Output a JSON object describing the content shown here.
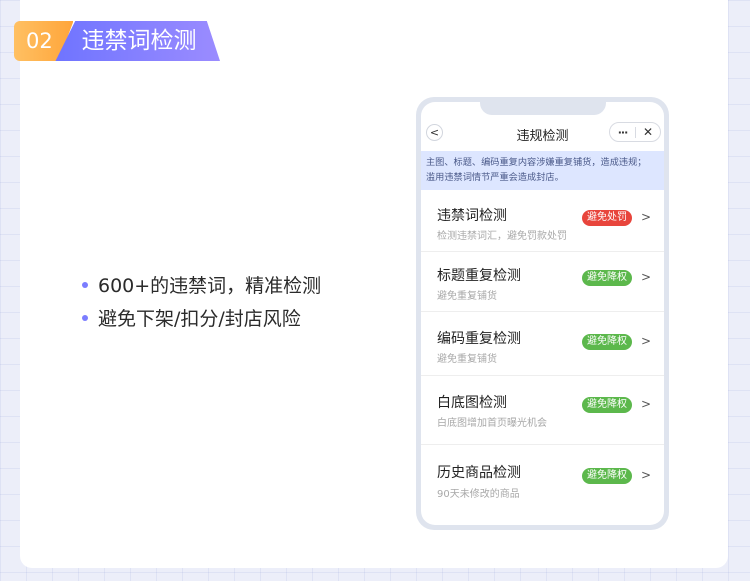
{
  "section": {
    "number": "02",
    "title": "违禁词检测"
  },
  "bullets": [
    "600+的违禁词，精准检测",
    "避免下架/扣分/封店风险"
  ],
  "phone": {
    "nav_title": "违规检测",
    "back_glyph": "<",
    "more_glyph": "···",
    "close_glyph": "✕",
    "notice_line1": "主图、标题、编码重复内容涉嫌重复铺货，造成违规；",
    "notice_line2": "滥用违禁词情节严重会造成封店。",
    "items": [
      {
        "title": "违禁词检测",
        "subtitle": "检测违禁词汇，避免罚款处罚",
        "tag": "避免处罚",
        "tag_color": "#e8453c"
      },
      {
        "title": "标题重复检测",
        "subtitle": "避免重复铺货",
        "tag": "避免降权",
        "tag_color": "#5cb84c"
      },
      {
        "title": "编码重复检测",
        "subtitle": "避免重复铺货",
        "tag": "避免降权",
        "tag_color": "#5cb84c"
      },
      {
        "title": "白底图检测",
        "subtitle": "白底图增加首页曝光机会",
        "tag": "避免降权",
        "tag_color": "#5cb84c"
      },
      {
        "title": "历史商品检测",
        "subtitle": "90天未修改的商品",
        "tag": "避免降权",
        "tag_color": "#5cb84c"
      }
    ],
    "arrow_glyph": ">"
  }
}
